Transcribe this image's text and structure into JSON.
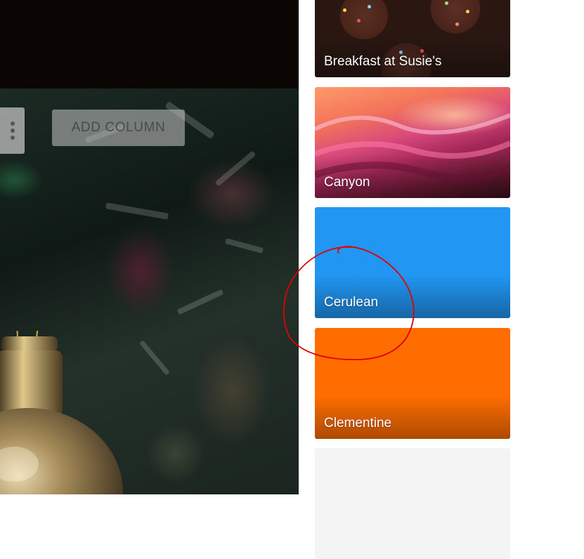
{
  "board": {
    "add_column_label": "ADD COLUMN"
  },
  "background_picker": {
    "tiles": [
      {
        "label": "Breakfast at Susie's",
        "kind": "photo"
      },
      {
        "label": "Canyon",
        "kind": "photo"
      },
      {
        "label": "Cerulean",
        "kind": "color",
        "color": "#2196f3"
      },
      {
        "label": "Clementine",
        "kind": "color",
        "color": "#ff6d00"
      },
      {
        "label": "",
        "kind": "color",
        "color": "#f4f4f4"
      }
    ]
  },
  "annotation": {
    "color": "#e00000",
    "shape": "hand-drawn circle around Cerulean"
  },
  "icons": {
    "column_menu": "more-vert-icon"
  }
}
